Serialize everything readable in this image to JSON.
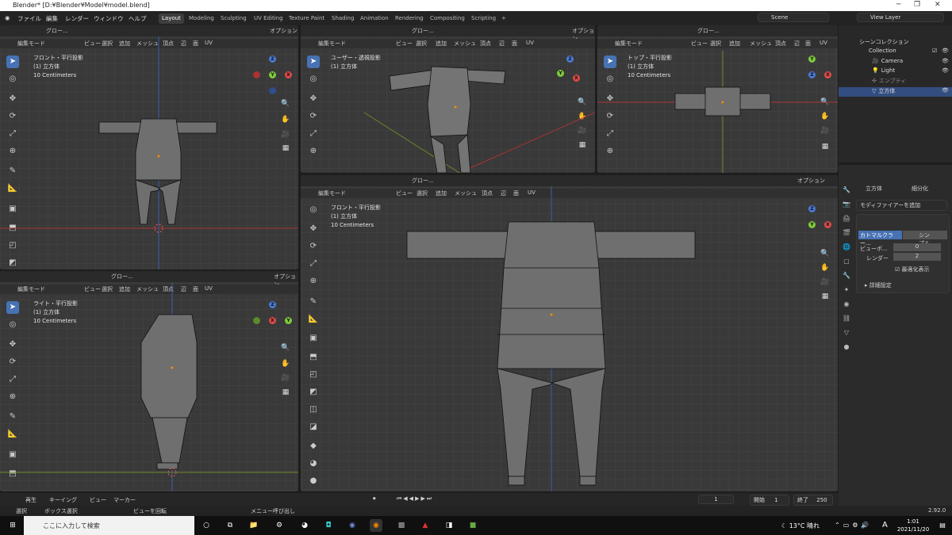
{
  "window": {
    "title": "Blender* [D:¥Blender¥Model¥model.blend]"
  },
  "menus": [
    "ファイル",
    "編集",
    "レンダー",
    "ウィンドウ",
    "ヘルプ"
  ],
  "workspaces": [
    "Layout",
    "Modeling",
    "Sculpting",
    "UV Editing",
    "Texture Paint",
    "Shading",
    "Animation",
    "Rendering",
    "Compositing",
    "Scripting"
  ],
  "scene": "Scene",
  "view_layer": "View Layer",
  "header": {
    "mode": "編集モード",
    "items": [
      "ビュー",
      "選択",
      "追加",
      "メッシュ",
      "頂点",
      "辺",
      "面",
      "UV"
    ],
    "global": "グロー...",
    "options": "オプション"
  },
  "viewports": {
    "front": {
      "title": "フロント・平行投影",
      "object": "(1) 立方体",
      "scale": "10 Centimeters"
    },
    "user": {
      "title": "ユーザー・透視投影",
      "object": "(1) 立方体"
    },
    "top": {
      "title": "トップ・平行投影",
      "object": "(1) 立方体",
      "scale": "10 Centimeters"
    },
    "right": {
      "title": "ライト・平行投影",
      "object": "(1) 立方体",
      "scale": "10 Centimeters"
    },
    "main": {
      "title": "フロント・平行投影",
      "object": "(1) 立方体",
      "scale": "10 Centimeters"
    }
  },
  "outliner": {
    "root": "シーンコレクション",
    "collection": "Collection",
    "items": [
      "Camera",
      "Light",
      "エンプティ",
      "立方体"
    ]
  },
  "properties": {
    "object": "立方体",
    "subdivide": "細分化",
    "add_modifier": "モディファイアーを追加",
    "catmull": "カトマルクラー...",
    "simple": "シンプル",
    "viewport_label": "ビューポ...",
    "viewport_val": "0",
    "render_label": "レンダー",
    "render_val": "2",
    "optimal": "最適化表示",
    "advanced": "詳細設定"
  },
  "timeline": {
    "playback": "再生",
    "keying": "キーイング",
    "view": "ビュー",
    "marker": "マーカー",
    "frame": "1",
    "start_label": "開始",
    "start": "1",
    "end_label": "終了",
    "end": "250"
  },
  "status": {
    "select": "選択",
    "box": "ボックス選択",
    "rotate": "ビューを回転",
    "menu": "メニュー呼び出し",
    "version": "2.92.0"
  },
  "taskbar": {
    "search": "ここに入力して検索",
    "weather": "13°C 晴れ",
    "time": "1:01",
    "date": "2021/11/20",
    "ime": "A"
  }
}
